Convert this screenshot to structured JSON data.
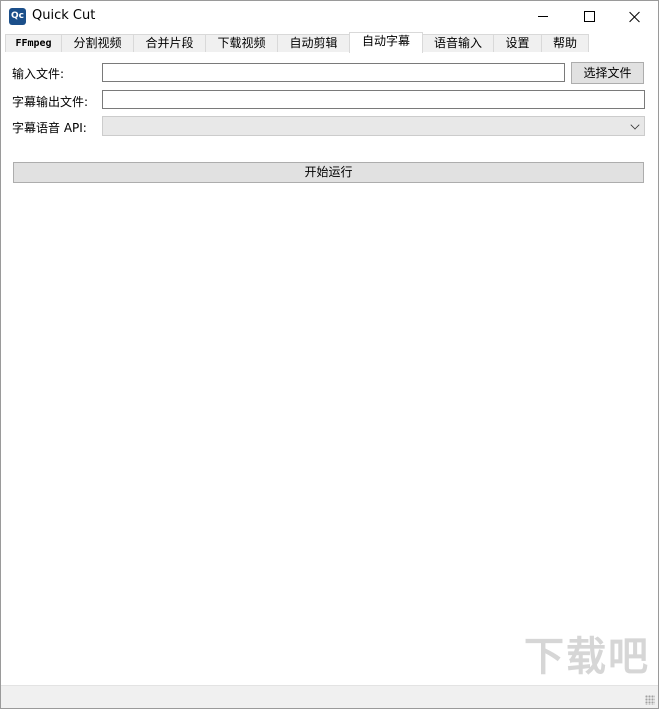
{
  "window": {
    "title": "Quick Cut",
    "icon_text": "Qc"
  },
  "tabs": [
    {
      "label": "FFmpeg",
      "active": false
    },
    {
      "label": "分割视频",
      "active": false
    },
    {
      "label": "合并片段",
      "active": false
    },
    {
      "label": "下载视频",
      "active": false
    },
    {
      "label": "自动剪辑",
      "active": false
    },
    {
      "label": "自动字幕",
      "active": true
    },
    {
      "label": "语音输入",
      "active": false
    },
    {
      "label": "设置",
      "active": false
    },
    {
      "label": "帮助",
      "active": false
    }
  ],
  "form": {
    "input_file_label": "输入文件:",
    "input_file_value": "",
    "choose_file_button": "选择文件",
    "output_file_label": "字幕输出文件:",
    "output_file_value": "",
    "api_label": "字幕语音 API:",
    "api_selected": "",
    "run_button": "开始运行"
  },
  "watermark": "下载吧"
}
